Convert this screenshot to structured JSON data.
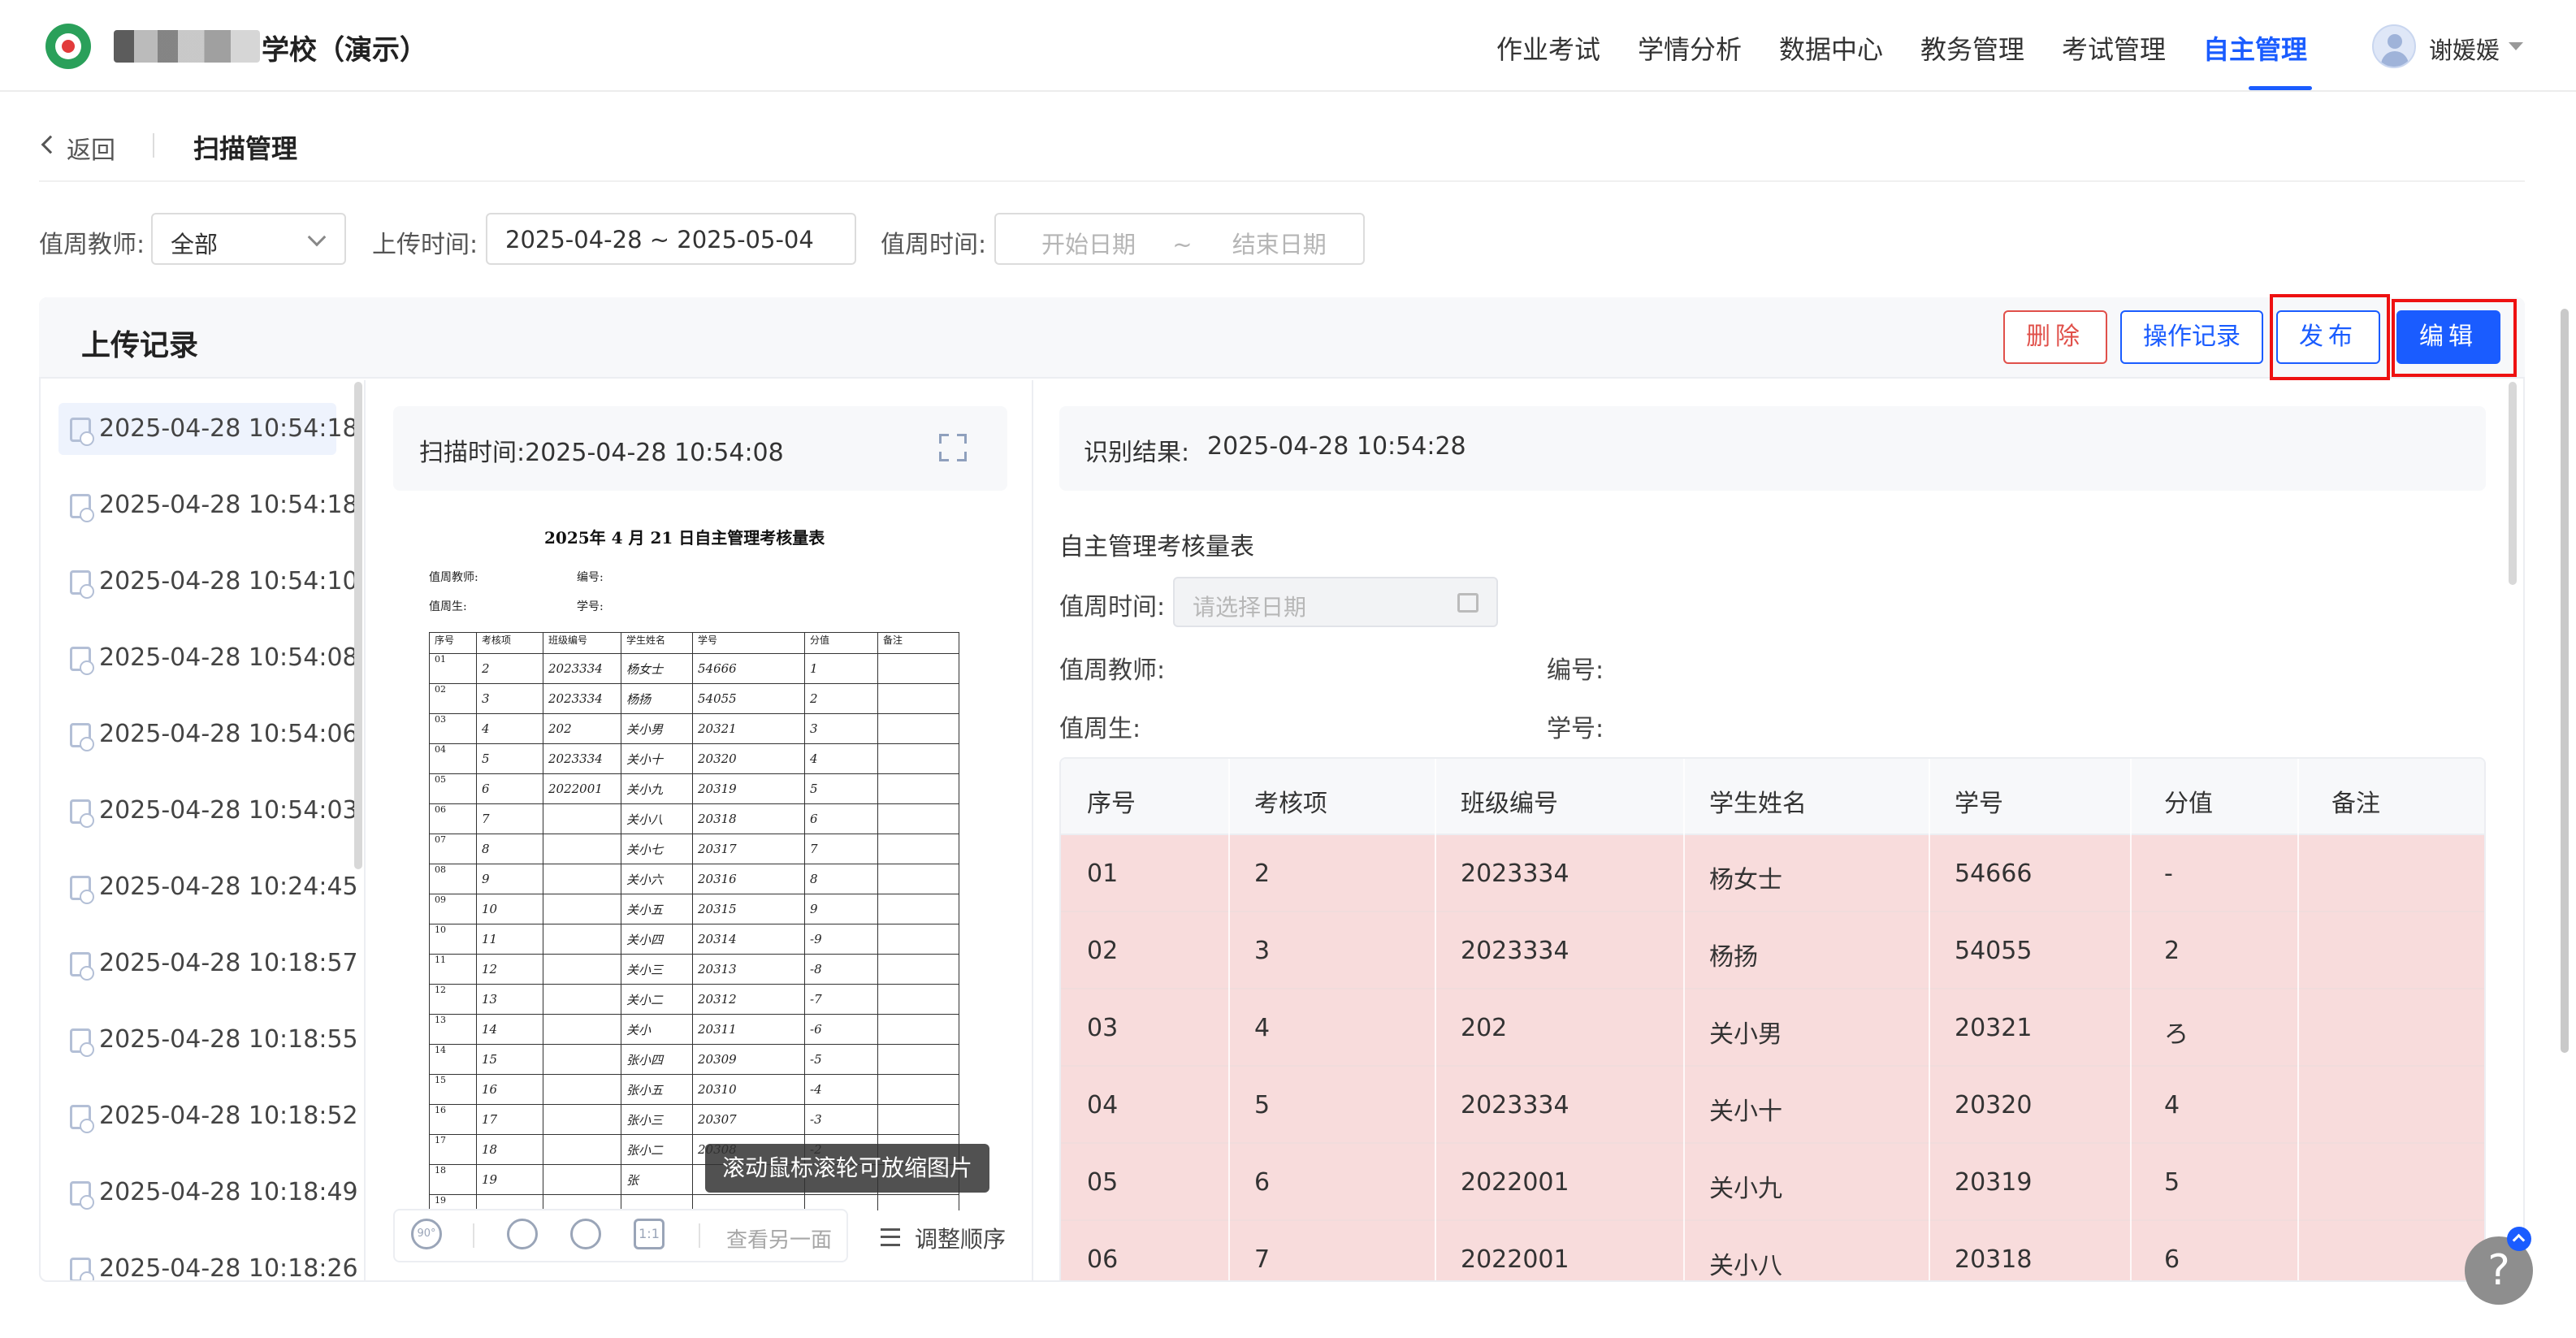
{
  "header": {
    "school_name": "学校（演示）",
    "nav": [
      "作业考试",
      "学情分析",
      "数据中心",
      "教务管理",
      "考试管理",
      "自主管理"
    ],
    "active_nav": "自主管理",
    "user_name": "谢媛媛"
  },
  "breadcrumb": {
    "back_label": "返回",
    "page_title": "扫描管理"
  },
  "filters": {
    "teacher_label": "值周教师:",
    "teacher_value": "全部",
    "upload_label": "上传时间:",
    "upload_value": "2025-04-28 ~ 2025-05-04",
    "duty_label": "值周时间:",
    "duty_start_placeholder": "开始日期",
    "duty_sep": "~",
    "duty_end_placeholder": "结束日期"
  },
  "panel": {
    "title": "上传记录",
    "buttons": {
      "delete": "删除",
      "log": "操作记录",
      "publish": "发布",
      "edit": "编辑"
    }
  },
  "upload_list": [
    "2025-04-28 10:54:18",
    "2025-04-28 10:54:18",
    "2025-04-28 10:54:10",
    "2025-04-28 10:54:08",
    "2025-04-28 10:54:06",
    "2025-04-28 10:54:03",
    "2025-04-28 10:24:45",
    "2025-04-28 10:18:57",
    "2025-04-28 10:18:55",
    "2025-04-28 10:18:52",
    "2025-04-28 10:18:49",
    "2025-04-28 10:18:26"
  ],
  "scan": {
    "label": "扫描时间:",
    "time": "2025-04-28 10:54:08",
    "sheet_title": "2025年 4 月 21 日自主管理考核量表",
    "sheet_meta": [
      "值周教师:",
      "编号:",
      "值周生:",
      "学号:"
    ],
    "sheet_headers": [
      "序号",
      "考核项",
      "班级编号",
      "学生姓名",
      "学号",
      "分值",
      "备注"
    ],
    "sheet_rows": [
      [
        "01",
        "2",
        "2023334",
        "杨女士",
        "54666",
        "1"
      ],
      [
        "02",
        "3",
        "2023334",
        "杨扬",
        "54055",
        "2"
      ],
      [
        "03",
        "4",
        "202",
        "关小男",
        "20321",
        "3"
      ],
      [
        "04",
        "5",
        "2023334",
        "关小十",
        "20320",
        "4"
      ],
      [
        "05",
        "6",
        "2022001",
        "关小九",
        "20319",
        "5"
      ],
      [
        "06",
        "7",
        "",
        "关小八",
        "20318",
        "6"
      ],
      [
        "07",
        "8",
        "",
        "关小七",
        "20317",
        "7"
      ],
      [
        "08",
        "9",
        "",
        "关小六",
        "20316",
        "8"
      ],
      [
        "09",
        "10",
        "",
        "关小五",
        "20315",
        "9"
      ],
      [
        "10",
        "11",
        "",
        "关小四",
        "20314",
        "-9"
      ],
      [
        "11",
        "12",
        "",
        "关小三",
        "20313",
        "-8"
      ],
      [
        "12",
        "13",
        "",
        "关小二",
        "20312",
        "-7"
      ],
      [
        "13",
        "14",
        "",
        "关小",
        "20311",
        "-6"
      ],
      [
        "14",
        "15",
        "",
        "张小四",
        "20309",
        "-5"
      ],
      [
        "15",
        "16",
        "",
        "张小五",
        "20310",
        "-4"
      ],
      [
        "16",
        "17",
        "",
        "张小三",
        "20307",
        "-3"
      ],
      [
        "17",
        "18",
        "",
        "张小二",
        "20308",
        "-2"
      ],
      [
        "18",
        "19",
        "",
        "张",
        "",
        ""
      ],
      [
        "19",
        "",
        "",
        "",
        "",
        ""
      ]
    ],
    "tooltip": "滚动鼠标滚轮可放缩图片",
    "toolbar_other": "查看另一面",
    "toolbar_ratio": "1:1",
    "toolbar_rotate": "90°",
    "reorder": "调整顺序"
  },
  "recognition": {
    "label": "识别结果:",
    "time": "2025-04-28 10:54:28",
    "form_title": "自主管理考核量表",
    "duty_time_label": "值周时间:",
    "duty_time_placeholder": "请选择日期",
    "teacher_label": "值周教师:",
    "number_label": "编号:",
    "student_label": "值周生:",
    "student_no_label": "学号:",
    "table_headers": [
      "序号",
      "考核项",
      "班级编号",
      "学生姓名",
      "学号",
      "分值",
      "备注"
    ],
    "table_rows": [
      [
        "01",
        "2",
        "2023334",
        "杨女士",
        "54666",
        "-",
        ""
      ],
      [
        "02",
        "3",
        "2023334",
        "杨扬",
        "54055",
        "2",
        ""
      ],
      [
        "03",
        "4",
        "202",
        "关小男",
        "20321",
        "ろ",
        ""
      ],
      [
        "04",
        "5",
        "2023334",
        "关小十",
        "20320",
        "4",
        ""
      ],
      [
        "05",
        "6",
        "2022001",
        "关小九",
        "20319",
        "5",
        ""
      ],
      [
        "06",
        "7",
        "2022001",
        "关小八",
        "20318",
        "6",
        ""
      ]
    ]
  },
  "help": "?",
  "colors": {
    "accent": "#1a5cff",
    "danger": "#e0504a",
    "row_error": "#f8dcdc",
    "highlight": "#e11111"
  }
}
